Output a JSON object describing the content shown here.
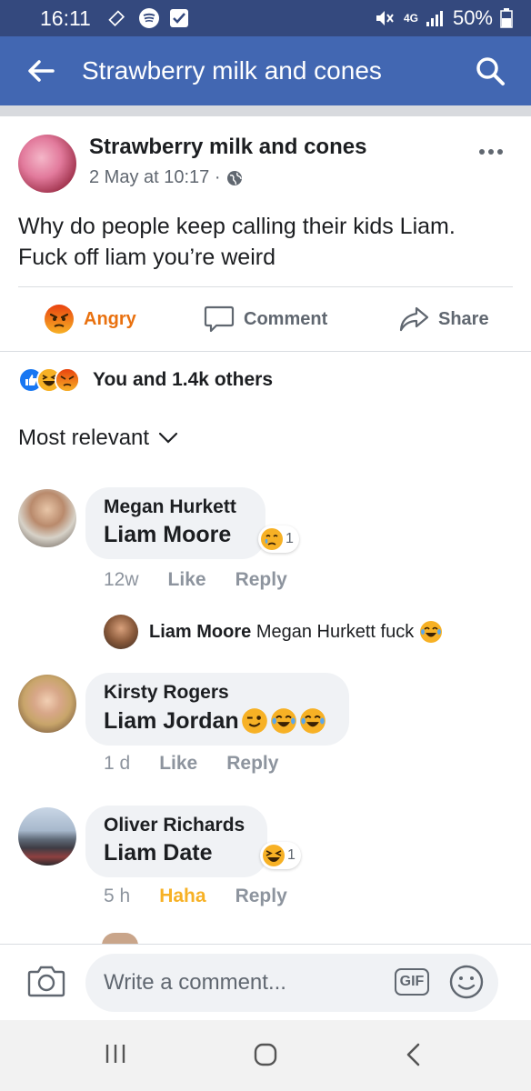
{
  "status_bar": {
    "time": "16:11",
    "network": "4G",
    "battery": "50%"
  },
  "header": {
    "title": "Strawberry milk and cones",
    "back_icon": "arrow-left-icon",
    "search_icon": "search-icon"
  },
  "post": {
    "author": "Strawberry milk and cones",
    "timestamp": "2 May at 10:17 ·",
    "privacy_icon": "globe-icon",
    "text_line1": "Why do people keep calling their kids Liam.",
    "text_line2": "Fuck off liam you’re weird",
    "actions": {
      "angry": "Angry",
      "comment": "Comment",
      "share": "Share"
    },
    "reactions_summary": "You and 1.4k others",
    "sort_label": "Most relevant"
  },
  "comments": [
    {
      "name": "Megan Hurkett",
      "text": "Liam Moore",
      "reaction_count": "1",
      "reaction": "cry",
      "time": "12w",
      "like": "Like",
      "reply": "Reply",
      "replies": [
        {
          "name": "Liam Moore",
          "text": "Megan Hurkett fuck"
        }
      ]
    },
    {
      "name": "Kirsty Rogers",
      "text": "Liam Jordan",
      "time": "1 d",
      "like": "Like",
      "reply": "Reply"
    },
    {
      "name": "Oliver Richards",
      "text": "Liam Date",
      "reaction_count": "1",
      "reaction": "haha",
      "time": "5 h",
      "like": "Haha",
      "reply": "Reply"
    }
  ],
  "composer": {
    "placeholder": "Write a comment...",
    "gif_label": "GIF"
  },
  "colors": {
    "status_bar": "#34497e",
    "app_bar": "#4267b2",
    "angry": "#e9710f",
    "haha": "#f7b125"
  }
}
